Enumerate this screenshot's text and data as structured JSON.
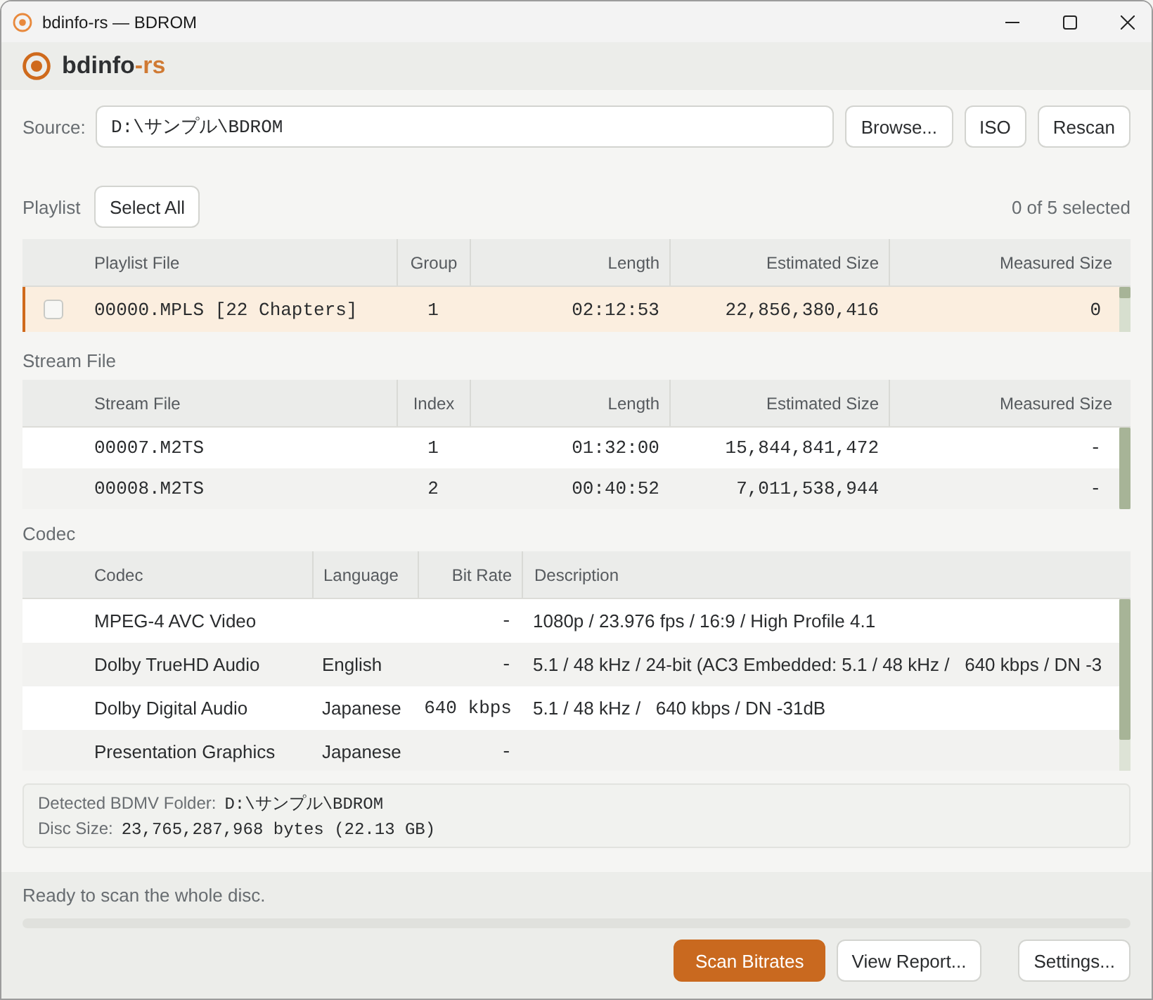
{
  "window": {
    "title": "bdinfo-rs — BDROM"
  },
  "app_header": {
    "title": "bdinfo",
    "title_suffix": "-rs"
  },
  "source": {
    "label": "Source:",
    "value": "D:\\サンプル\\BDROM",
    "buttons": [
      "Browse...",
      "ISO",
      "Rescan"
    ]
  },
  "playlist": {
    "label": "Playlist",
    "select_all_button": "Select All",
    "selection_count": "0 of 5 selected",
    "columns": [
      "Playlist File",
      "Group",
      "Length",
      "Estimated Size",
      "Measured Size"
    ],
    "rows": [
      {
        "selected": true,
        "checked": false,
        "file": "00000.MPLS [22 Chapters]",
        "group": "1",
        "length": "02:12:53",
        "estimated_size": "22,856,380,416",
        "measured_size": "0"
      }
    ]
  },
  "stream_files": {
    "label": "Stream File",
    "columns": [
      "Stream File",
      "Index",
      "Length",
      "Estimated Size",
      "Measured Size"
    ],
    "rows": [
      {
        "file": "00007.M2TS",
        "index": "1",
        "length": "01:32:00",
        "estimated_size": "15,844,841,472",
        "measured_size": "-"
      },
      {
        "file": "00008.M2TS",
        "index": "2",
        "length": "00:40:52",
        "estimated_size": "7,011,538,944",
        "measured_size": "-"
      }
    ]
  },
  "codecs": {
    "label": "Codec",
    "columns": [
      "Codec",
      "Language",
      "Bit Rate",
      "Description"
    ],
    "rows": [
      {
        "codec": "MPEG-4 AVC Video",
        "bit_rate": "-",
        "description": "1080p / 23.976 fps / 16:9 / High Profile 4.1"
      },
      {
        "codec": "Dolby TrueHD Audio",
        "language": "English",
        "bit_rate": "-",
        "description": "5.1 / 48 kHz / 24-bit (AC3 Embedded: 5.1 / 48 kHz /   640 kbps / DN -3"
      },
      {
        "codec": "Dolby Digital Audio",
        "language": "Japanese",
        "bit_rate": "640 kbps",
        "description": "5.1 / 48 kHz /   640 kbps / DN -31dB"
      },
      {
        "codec": "Presentation Graphics",
        "language": "Japanese",
        "bit_rate": "-"
      }
    ]
  },
  "disc_info": [
    {
      "label": "Detected BDMV Folder:",
      "value": "D:\\サンプル\\BDROM"
    },
    {
      "label": "Disc Size:",
      "value": "23,765,287,968 bytes (22.13 GB)"
    }
  ],
  "status": {
    "text": "Ready to scan the whole disc.",
    "level": 0
  },
  "actions": [
    {
      "label": "Scan Bitrates",
      "kind": "primary"
    },
    {
      "label": "View Report...",
      "kind": "default"
    },
    {
      "label": "Settings...",
      "kind": "default"
    }
  ]
}
